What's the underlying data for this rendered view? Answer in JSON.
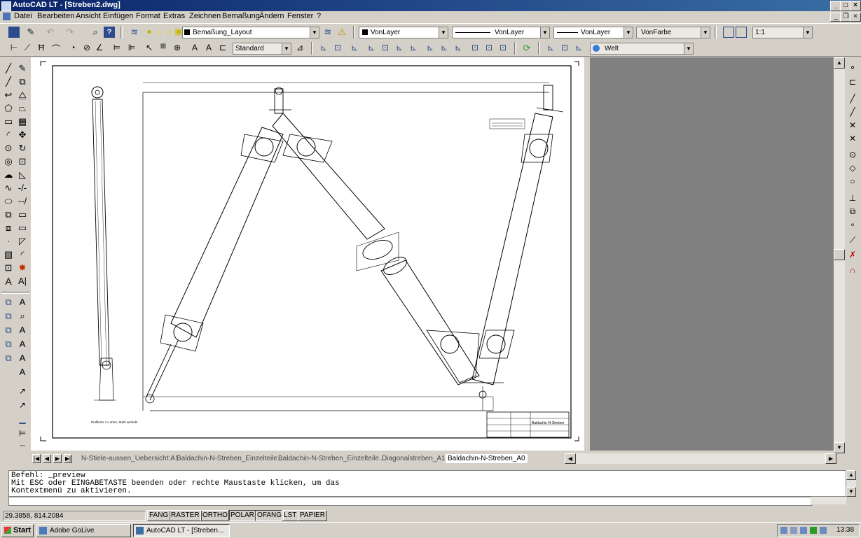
{
  "window": {
    "title": "AutoCAD LT - [Streben2.dwg]"
  },
  "menu": [
    "Datei",
    "Bearbeiten",
    "Ansicht",
    "Einfügen",
    "Format",
    "Extras",
    "Zeichnen",
    "Bemaßung",
    "Ändern",
    "Fenster",
    "?"
  ],
  "toolbar1": {
    "layer": "Bemaßung_Layout",
    "color": "VonLayer",
    "linetype": "VonLayer",
    "lineweight": "VonLayer",
    "plotstyle": "VonFarbe",
    "scale": "1:1"
  },
  "toolbar2": {
    "dimstyle": "Standard",
    "ucs": "Welt"
  },
  "tabs": [
    "N-Stiele-aussen_Uebersicht:A1",
    "Baldachin-N-Streben_Einzelteile...",
    "Baldachin-N-Streben_Einzelteile...",
    "Diagonalstreben_A1",
    "Baldachin-N-Streben_A0"
  ],
  "command": {
    "lines": [
      "Befehl: _preview",
      "Mit ESC oder EINGABETASTE beenden oder rechte Maustaste klicken, um das",
      "Kontextmenü zu aktivieren."
    ]
  },
  "status": {
    "coords": "29.3858,  814.2084",
    "buttons": [
      "FANG",
      "RASTER",
      "ORTHO",
      "POLAR",
      "OFANG",
      "LST",
      "PAPIER"
    ]
  },
  "taskbar": {
    "start": "Start",
    "items": [
      "Adobe GoLive",
      "AutoCAD LT - [Streben..."
    ],
    "clock": "13:38"
  },
  "drawing": {
    "note_bottom": "Profilrohr 4 x 4mm, Stahl verzinkt",
    "title_block": "Baldachin-N-Streben"
  }
}
